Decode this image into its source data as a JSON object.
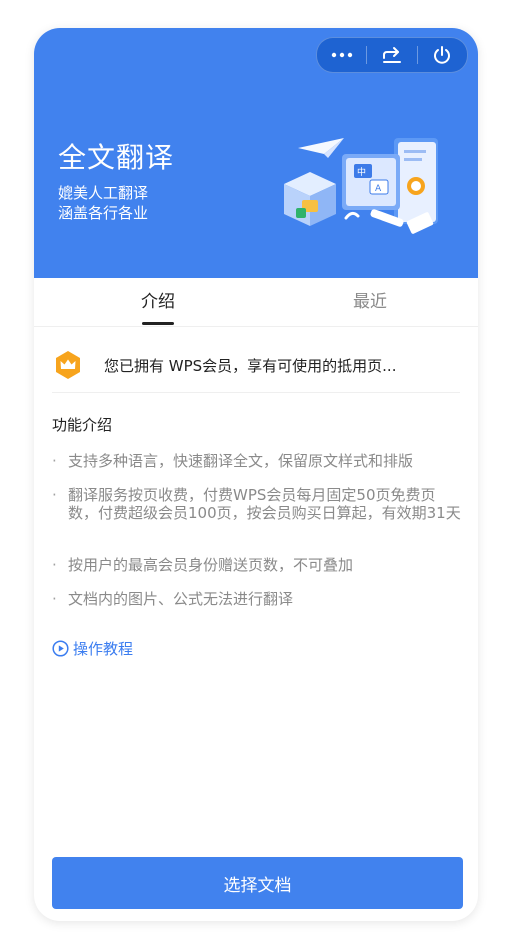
{
  "header": {
    "title": "全文翻译",
    "subtitle_line1": "媲美人工翻译",
    "subtitle_line2": "涵盖各行各业",
    "bg_color": "#4182ee"
  },
  "capsule": {
    "more_icon": "more-dots-icon",
    "share_icon": "share-arrow-icon",
    "power_icon": "power-icon"
  },
  "tabs": [
    {
      "label": "介绍",
      "active": true
    },
    {
      "label": "最近",
      "active": false
    }
  ],
  "member": {
    "text": "您已拥有 WPS会员，享有可使用的抵用页...",
    "icon": "crown-badge-icon",
    "icon_color": "#f7a41d"
  },
  "features": {
    "title": "功能介绍",
    "items": [
      "支持多种语言，快速翻译全文，保留原文样式和排版",
      "翻译服务按页收费，付费WPS会员每月固定50页免费页数，付费超级会员100页，按会员购买日算起，有效期31天",
      "按用户的最高会员身份赠送页数，不可叠加",
      "文档内的图片、公式无法进行翻译"
    ]
  },
  "tutorial": {
    "label": "操作教程",
    "icon": "play-circle-icon",
    "color": "#3b7df0"
  },
  "primary_button": {
    "label": "选择文档"
  }
}
